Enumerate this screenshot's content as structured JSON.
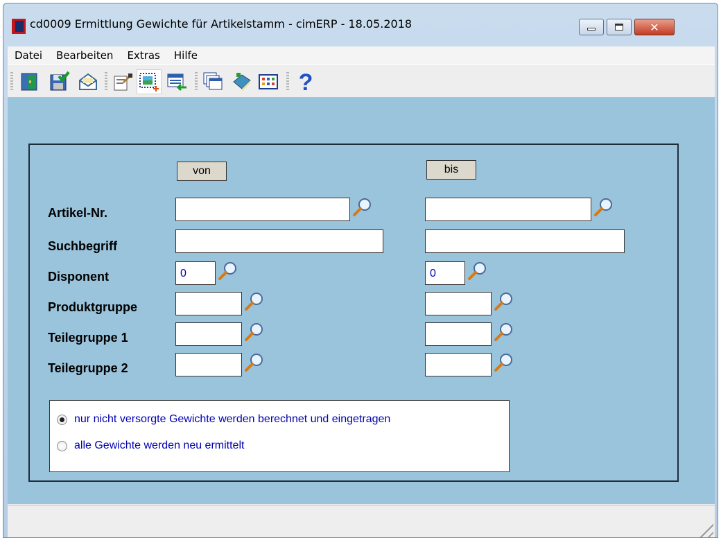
{
  "window": {
    "title": "cd0009 Ermittlung Gewichte für Artikelstamm - cimERP - 18.05.2018"
  },
  "menu": [
    "Datei",
    "Bearbeiten",
    "Extras",
    "Hilfe"
  ],
  "toolbar": {
    "icons": [
      "exit-icon",
      "save-icon",
      "mail-icon",
      "edit-icon",
      "new-selection-icon",
      "list-transfer-icon",
      "windows-icon",
      "book-icon",
      "grid-icon",
      "help-icon"
    ]
  },
  "form": {
    "von_label": "von",
    "bis_label": "bis",
    "fields": {
      "artikel_nr": {
        "label": "Artikel-Nr.",
        "von": "",
        "bis": ""
      },
      "suchbegriff": {
        "label": "Suchbegriff",
        "von": "",
        "bis": ""
      },
      "disponent": {
        "label": "Disponent",
        "von": "0",
        "bis": "0"
      },
      "produktgruppe": {
        "label": "Produktgruppe",
        "von": "",
        "bis": ""
      },
      "teilegruppe1": {
        "label": "Teilegruppe 1",
        "von": "",
        "bis": ""
      },
      "teilegruppe2": {
        "label": "Teilegruppe 2",
        "von": "",
        "bis": ""
      }
    },
    "options": {
      "opt1": "nur nicht versorgte Gewichte werden berechnet und eingetragen",
      "opt2": "alle Gewichte werden neu ermittelt",
      "selected": "opt1"
    }
  },
  "colors": {
    "client_bg": "#9ac3dc",
    "input_text": "#0000c0",
    "option_text": "#0000b0"
  }
}
